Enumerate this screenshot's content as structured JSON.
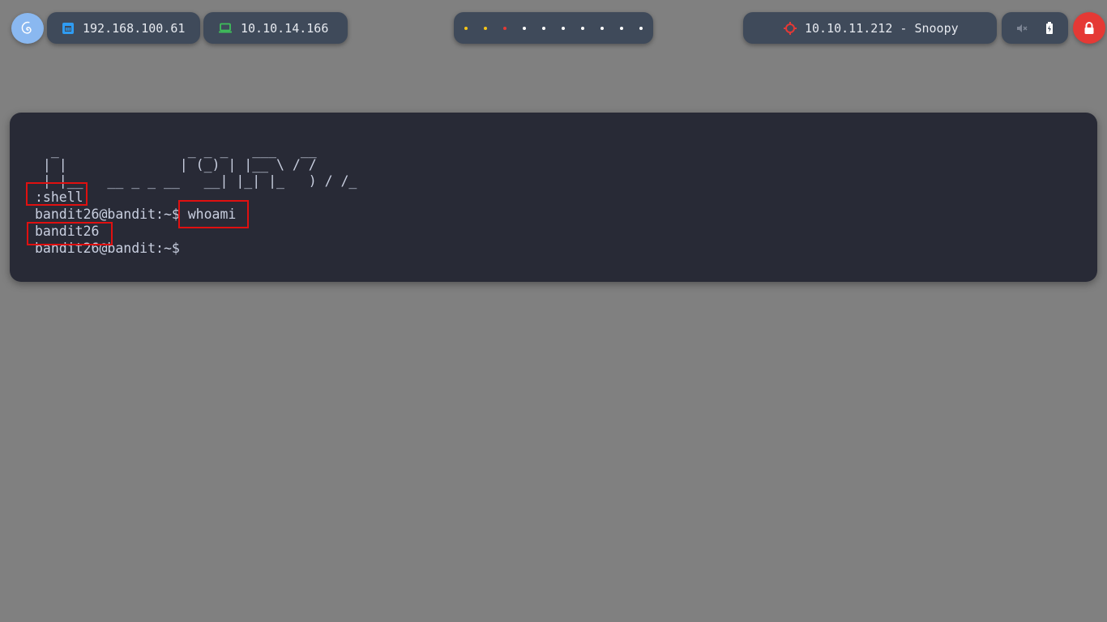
{
  "topbar": {
    "ethernet_ip": "192.168.100.61",
    "vpn_ip": "10.10.14.166",
    "workspace_dot_colors": [
      "#f5c518",
      "#f5c518",
      "#e53935",
      "#ffffff",
      "#ffffff",
      "#ffffff",
      "#ffffff",
      "#ffffff",
      "#ffffff",
      "#ffffff"
    ],
    "target": "10.10.11.212 - Snoopy",
    "icons": {
      "logo": "debian-swirl-icon",
      "ethernet": "ethernet-icon",
      "vpn": "laptop-icon",
      "target": "crosshair-icon",
      "mute": "mute-icon",
      "battery": "battery-icon",
      "lock": "lock-icon"
    },
    "colors": {
      "accent_blue": "#2f9cf2",
      "vpn_green": "#3fbf5a",
      "target_red": "#e53935"
    }
  },
  "terminal": {
    "ascii_art": [
      "  _                _ _ _   ___   __",
      " | |              | (_) | |__ \\ / /",
      " | |__   __ _ _ __   __| |_| |_   ) / /_"
    ],
    "lines": [
      ":shell",
      "bandit26@bandit:~$ whoami",
      "bandit26",
      "bandit26@bandit:~$"
    ],
    "prompt": "bandit26@bandit:~$",
    "command": "whoami",
    "output": "bandit26"
  }
}
